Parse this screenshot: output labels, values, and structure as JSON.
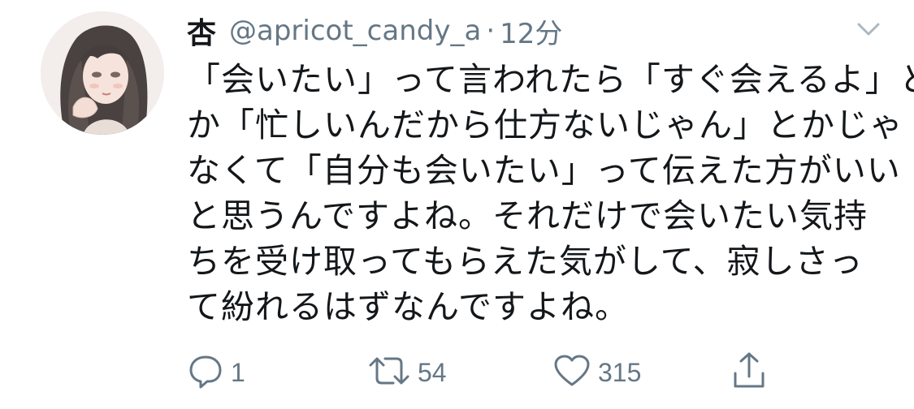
{
  "tweet": {
    "display_name": "杏",
    "handle": "@apricot_candy_a",
    "separator": "·",
    "time": "12分",
    "text_lines": [
      "「会いたい」って言われたら「すぐ会えるよ」と",
      "か「忙しいんだから仕方ないじゃん」とかじゃ",
      "なくて「自分も会いたい」って伝えた方がいい",
      "と思うんですよね。それだけで会いたい気持",
      "ちを受け取ってもらえた気がして、寂しさっ",
      "て紛れるはずなんですよね。"
    ],
    "actions": {
      "reply_count": "1",
      "retweet_count": "54",
      "like_count": "315"
    },
    "icons": {
      "menu": "chevron-down-icon",
      "reply": "reply-icon",
      "retweet": "retweet-icon",
      "like": "heart-icon",
      "share": "share-icon"
    }
  },
  "colors": {
    "text": "#14171a",
    "secondary": "#657786",
    "caret": "#aab8c2"
  }
}
